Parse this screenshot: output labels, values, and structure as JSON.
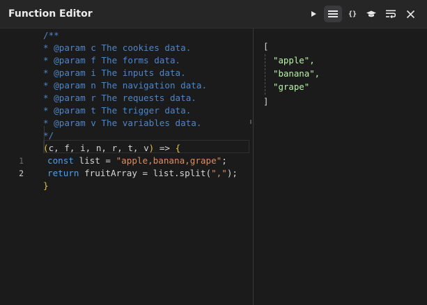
{
  "window": {
    "title": "Function Editor"
  },
  "toolbar": {
    "buttons": [
      {
        "icon": "play-icon",
        "label": "Run"
      },
      {
        "icon": "list-view-icon",
        "label": "List view",
        "active": true
      },
      {
        "icon": "braces-icon",
        "glyph": "{}"
      },
      {
        "icon": "grad-cap-icon"
      },
      {
        "icon": "word-wrap-icon"
      },
      {
        "icon": "close-icon"
      }
    ]
  },
  "editor": {
    "comment_lines": [
      "/**",
      "* @param c The cookies data.",
      "* @param f The forms data.",
      "* @param i The inputs data.",
      "* @param n The navigation data.",
      "* @param r The requests data.",
      "* @param t The trigger data.",
      "* @param v The variables data.",
      "*/"
    ],
    "signature": {
      "open_paren": "(",
      "params": "c, f, i, n, r, t, v",
      "close_paren": ")",
      "arrow": " => ",
      "open_brace": "{"
    },
    "body": [
      {
        "number": "1",
        "kw": "const",
        "code": " list = ",
        "str": "\"apple,banana,grape\"",
        "tail": ";"
      },
      {
        "number": "2",
        "kw": "return",
        "code": " fruitArray = list.split(",
        "str": "\",\"",
        "tail": ");"
      }
    ],
    "close_brace": "}"
  },
  "output": {
    "open_bracket": "[",
    "items": [
      "\"apple\",",
      "\"banana\",",
      "\"grape\""
    ],
    "close_bracket": "]"
  },
  "colors": {
    "comment": "#4f86c6",
    "keyword": "#4fa0e6",
    "string": "#e08d5e",
    "brace": "#e6c23a",
    "json_string": "#b9f2a6"
  }
}
